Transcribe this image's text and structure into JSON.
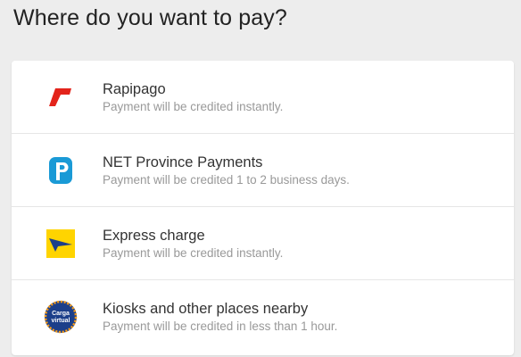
{
  "page": {
    "title": "Where do you want to pay?"
  },
  "options": [
    {
      "title": "Rapipago",
      "subtitle": "Payment will be credited instantly.",
      "icon": "rapipago-logo-icon",
      "color": "#e3241b"
    },
    {
      "title": "NET Province Payments",
      "subtitle": "Payment will be credited 1 to 2 business days.",
      "icon": "provincia-net-logo-icon",
      "color": "#1a9ad6"
    },
    {
      "title": "Express charge",
      "subtitle": "Payment will be credited instantly.",
      "icon": "express-charge-logo-icon",
      "color": "#ffd400"
    },
    {
      "title": "Kiosks and other places nearby",
      "subtitle": "Payment will be credited in less than 1 hour.",
      "icon": "carga-virtual-logo-icon",
      "logo_text": [
        "Carga",
        "virtual"
      ],
      "color": "#1c3f8a"
    }
  ],
  "colors": {
    "background": "#ededed",
    "card": "#ffffff",
    "title_text": "#333333",
    "subtitle_text": "#999999"
  }
}
